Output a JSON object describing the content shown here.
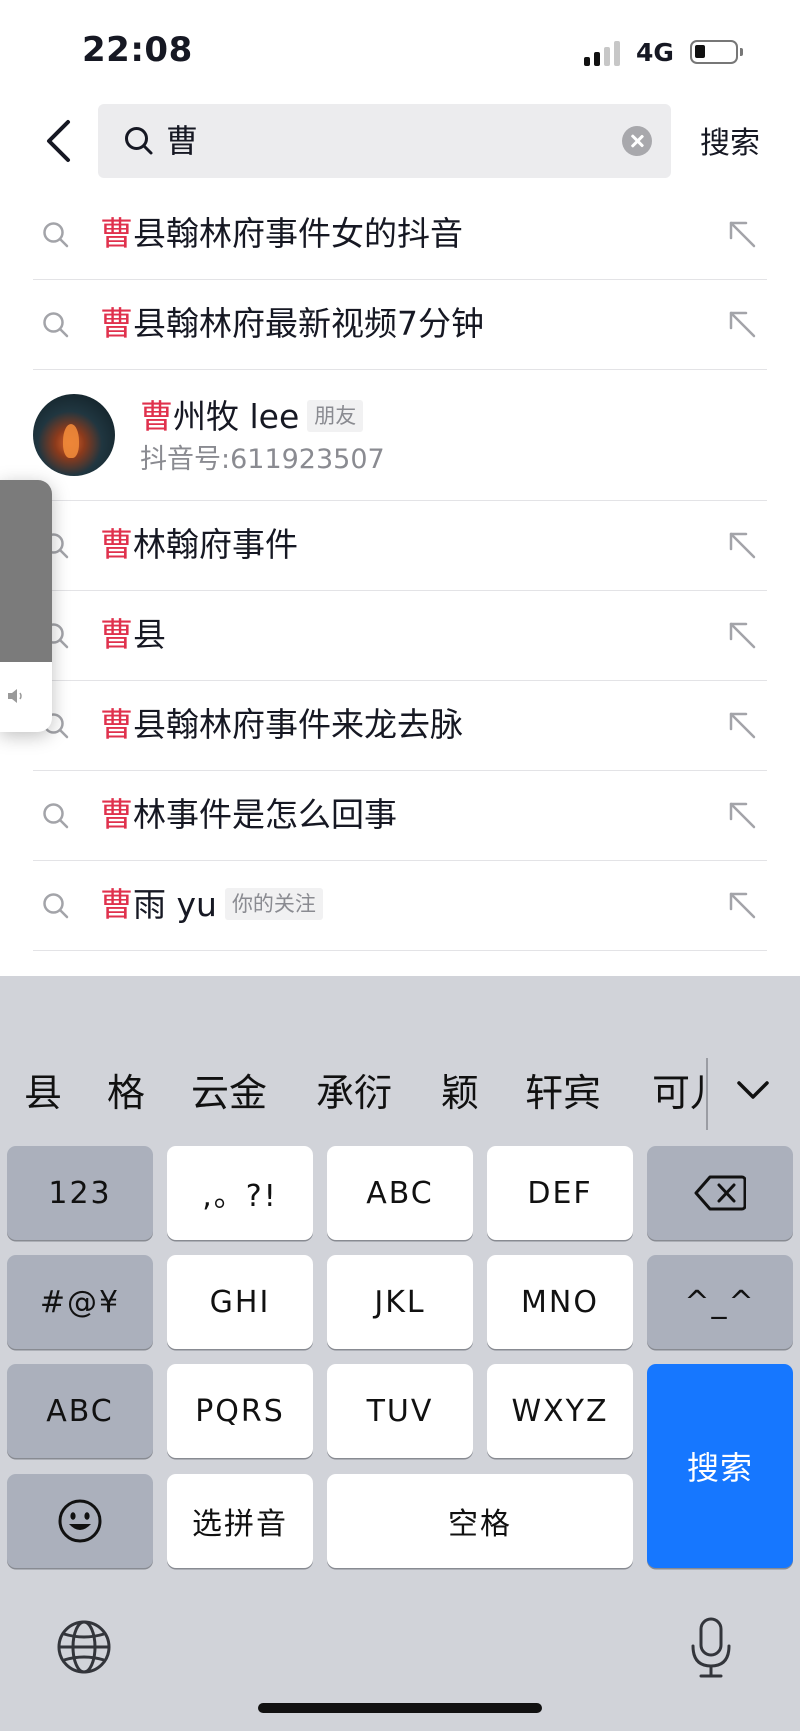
{
  "status_bar": {
    "time": "22:08",
    "network": "4G"
  },
  "search": {
    "query": "曹",
    "submit_label": "搜索"
  },
  "suggestions": [
    {
      "highlight": "曹",
      "rest": "县翰林府事件女的抖音"
    },
    {
      "highlight": "曹",
      "rest": "县翰林府最新视频7分钟"
    },
    {
      "highlight": "曹",
      "rest": "林翰府事件"
    },
    {
      "highlight": "曹",
      "rest": "县"
    },
    {
      "highlight": "曹",
      "rest": "县翰林府事件来龙去脉"
    },
    {
      "highlight": "曹",
      "rest": "林事件是怎么回事"
    },
    {
      "highlight": "曹",
      "rest": "雨 yu",
      "tag": "你的关注"
    }
  ],
  "user_result": {
    "highlight": "曹",
    "rest": "州牧 lee",
    "tag": "朋友",
    "douyin_id": "抖音号:611923507"
  },
  "keyboard": {
    "candidates": [
      "县",
      "格",
      "云金",
      "承衍",
      "颖",
      "轩宾",
      "可儿"
    ],
    "keys": {
      "num": "123",
      "punct": ",。?!",
      "abc_key": "ABC",
      "def": "DEF",
      "symbols": "#@¥",
      "ghi": "GHI",
      "jkl": "JKL",
      "mno": "MNO",
      "emoticon": "^_^",
      "abc": "ABC",
      "pqrs": "PQRS",
      "tuv": "TUV",
      "wxyz": "WXYZ",
      "search": "搜索",
      "pinyin": "选拼音",
      "space": "空格"
    }
  },
  "icons": {
    "back": "chevron-left-icon",
    "search": "search-icon",
    "clear": "clear-icon",
    "fill_in": "arrow-up-left-icon",
    "backspace": "backspace-icon",
    "emoji": "emoji-icon",
    "globe": "globe-icon",
    "microphone": "microphone-icon",
    "expand": "chevron-down-icon"
  },
  "colors": {
    "highlight": "#e0314d",
    "search_key": "#1677ff"
  }
}
